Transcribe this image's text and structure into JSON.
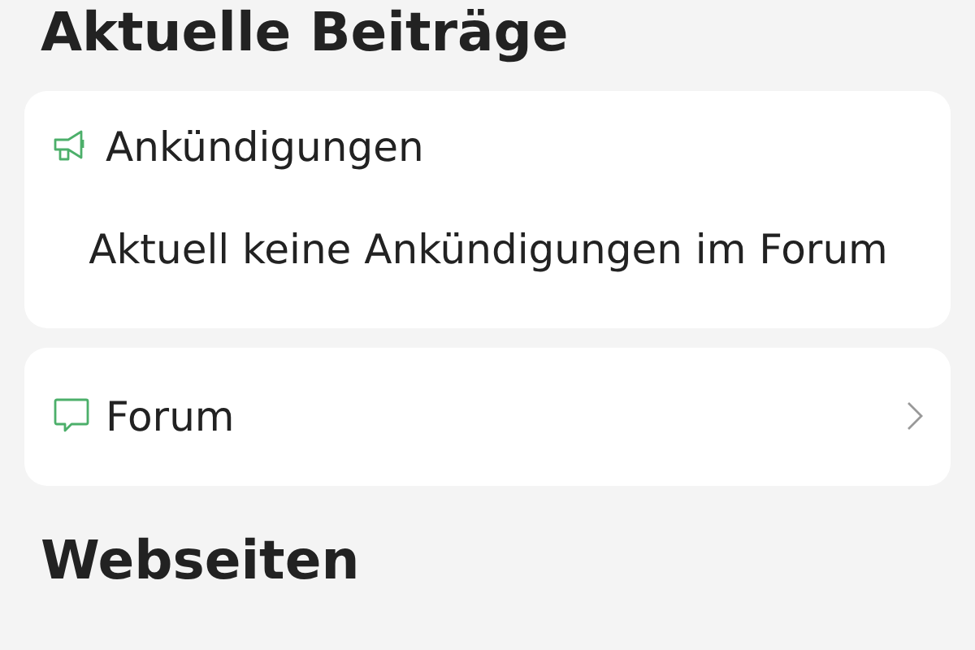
{
  "sections": [
    {
      "heading": "Aktuelle Beiträge",
      "cards": [
        {
          "kind": "announcements",
          "title": "Ankündigungen",
          "body": "Aktuell keine Ankündigungen im Forum"
        },
        {
          "kind": "forum",
          "title": "Forum"
        }
      ]
    },
    {
      "heading": "Webseiten"
    }
  ]
}
